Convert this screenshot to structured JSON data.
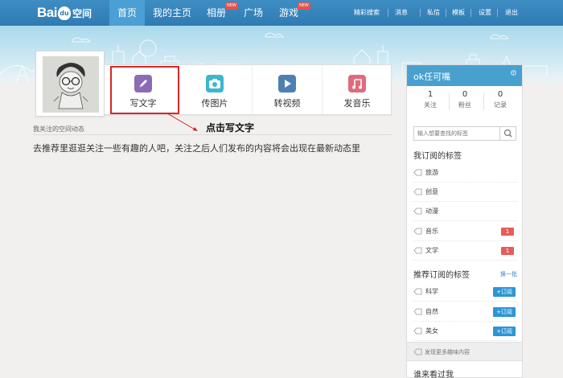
{
  "nav": {
    "items": [
      {
        "label": "首页",
        "active": true
      },
      {
        "label": "我的主页"
      },
      {
        "label": "相册",
        "badge": "NEW"
      },
      {
        "label": "广场"
      },
      {
        "label": "游戏",
        "badge": "NEW"
      }
    ],
    "utilities": [
      "精彩搜索",
      "消息",
      "私信",
      "模板",
      "设置",
      "退出"
    ]
  },
  "actions": [
    {
      "label": "写文字",
      "icon": "pencil-icon",
      "color": "#8b6bb6"
    },
    {
      "label": "传图片",
      "icon": "camera-icon",
      "color": "#3ab6cf"
    },
    {
      "label": "转视频",
      "icon": "play-icon",
      "color": "#4d7fb3"
    },
    {
      "label": "发音乐",
      "icon": "music-icon",
      "color": "#e06a7a"
    }
  ],
  "annotation": "点击写文字",
  "feed": {
    "title": "我关注的空间动态",
    "message": "去推荐里逛逛关注一些有趣的人吧，关注之后人们发布的内容将会出现在最新动态里"
  },
  "sidebar": {
    "username": "ok任可嘴",
    "stats": [
      {
        "num": "1",
        "label": "关注"
      },
      {
        "num": "0",
        "label": "粉丝"
      },
      {
        "num": "0",
        "label": "记录"
      }
    ],
    "search_placeholder": "输入想要查找的标签",
    "subscribed_title": "我订阅的标签",
    "subscribed": [
      {
        "name": "旅游"
      },
      {
        "name": "创意"
      },
      {
        "name": "动漫"
      },
      {
        "name": "音乐",
        "count": "1"
      },
      {
        "name": "文学",
        "count": "1"
      }
    ],
    "recommended_title": "推荐订阅的标签",
    "refresh_label": "换一批",
    "recommended": [
      {
        "name": "科学",
        "button": "+订阅"
      },
      {
        "name": "自然",
        "button": "+订阅"
      },
      {
        "name": "美女",
        "button": "+订阅"
      }
    ],
    "discover": "发现更多趣味内容",
    "who_viewed": "谁来看过我"
  },
  "colors": {
    "nav_bg": "#2f7bb3",
    "accent": "#48a0cf",
    "highlight": "#d42828",
    "count_badge": "#e35d5b",
    "subscribe": "#2c95d6"
  }
}
